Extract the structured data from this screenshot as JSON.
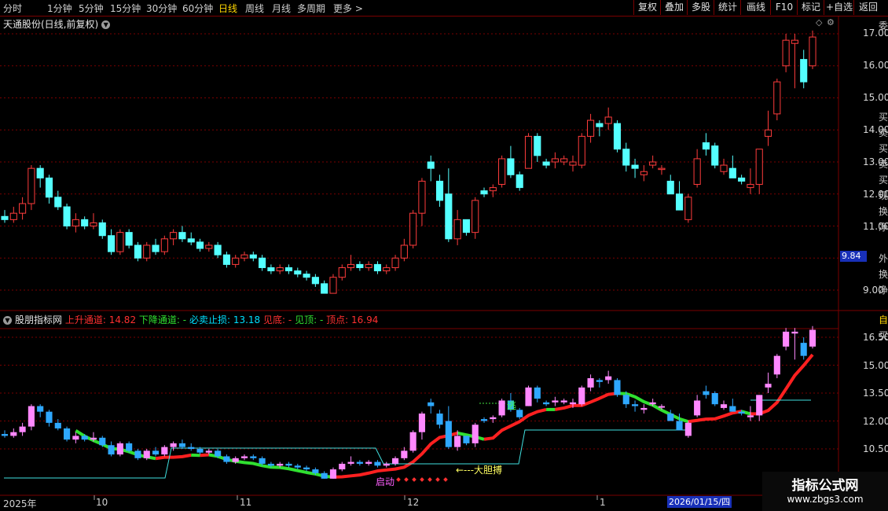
{
  "toolbar": {
    "periods": [
      "分时",
      "1分钟",
      "5分钟",
      "15分钟",
      "30分钟",
      "60分钟",
      "日线",
      "周线",
      "月线",
      "多周期",
      "更多 >"
    ],
    "active_period": "日线",
    "tools": [
      "复权",
      "叠加",
      "多股",
      "统计",
      "画线",
      "F10",
      "标记",
      "+自选",
      "返回"
    ]
  },
  "main_panel": {
    "title": "天通股份(日线,前复权)",
    "y_ticks": [
      "17.00",
      "16.00",
      "15.00",
      "14.00",
      "13.00",
      "12.00",
      "11.00",
      "9.00"
    ],
    "current_price": "9.84",
    "right_strip": [
      "委",
      "买",
      "卖",
      "买",
      "卖",
      "买",
      "现",
      "换",
      "净",
      "外",
      "换",
      "净"
    ]
  },
  "indicator_panel": {
    "name": "股朋指标网",
    "items": [
      {
        "label": "上升通道:",
        "value": "14.82",
        "color": "#ff3030"
      },
      {
        "label": "下降通道:",
        "value": "-",
        "color": "#30e030"
      },
      {
        "label": "必卖止损:",
        "value": "13.18",
        "color": "#00e0ff"
      },
      {
        "label": "见底:",
        "value": "-",
        "color": "#ff3030"
      },
      {
        "label": "见顶:",
        "value": "-",
        "color": "#30e030"
      },
      {
        "label": "顶点:",
        "value": "16.94",
        "color": "#ff3030"
      }
    ],
    "y_ticks": [
      "16.50",
      "15.00",
      "13.50",
      "12.00",
      "10.50"
    ],
    "annotations": {
      "escape": "逃",
      "bold_bet": "←---大胆搏",
      "start": "启动",
      "top_marker": "自",
      "side_marker": "买"
    }
  },
  "x_axis": {
    "labels": [
      "2025年",
      "10",
      "11",
      "12",
      "1"
    ],
    "cursor_date": "2026/01/15/四"
  },
  "watermark": {
    "title": "指标公式网",
    "url": "www.zbgs3.com"
  },
  "colors": {
    "up": "#ff3c3c",
    "down": "#54ffff",
    "ind_up": "#ff88ff",
    "ind_down": "#2ea8ff",
    "grid": "#7a0000",
    "accent": "#ffd700"
  },
  "chart_data": {
    "type": "candlestick",
    "title": "天通股份(日线,前复权)",
    "ylim": [
      8.6,
      17.4
    ],
    "ohlc": [
      [
        11.3,
        11.5,
        11.1,
        11.2
      ],
      [
        11.2,
        11.6,
        11.1,
        11.4
      ],
      [
        11.4,
        11.9,
        11.2,
        11.7
      ],
      [
        11.7,
        12.9,
        11.5,
        12.8
      ],
      [
        12.8,
        12.9,
        12.2,
        12.5
      ],
      [
        12.5,
        12.6,
        11.7,
        11.9
      ],
      [
        11.9,
        12.1,
        11.5,
        11.6
      ],
      [
        11.6,
        11.7,
        10.9,
        11.0
      ],
      [
        11.0,
        11.4,
        10.8,
        11.2
      ],
      [
        11.2,
        11.3,
        10.9,
        11.0
      ],
      [
        11.0,
        11.4,
        10.9,
        11.1
      ],
      [
        11.1,
        11.2,
        10.6,
        10.7
      ],
      [
        10.7,
        10.9,
        10.1,
        10.2
      ],
      [
        10.2,
        10.9,
        10.1,
        10.8
      ],
      [
        10.8,
        10.9,
        10.3,
        10.4
      ],
      [
        10.4,
        10.5,
        9.9,
        10.0
      ],
      [
        10.0,
        10.5,
        9.9,
        10.4
      ],
      [
        10.4,
        10.6,
        10.1,
        10.2
      ],
      [
        10.2,
        10.7,
        10.1,
        10.6
      ],
      [
        10.6,
        10.9,
        10.4,
        10.8
      ],
      [
        10.8,
        11.0,
        10.5,
        10.6
      ],
      [
        10.6,
        10.8,
        10.4,
        10.5
      ],
      [
        10.5,
        10.6,
        10.2,
        10.3
      ],
      [
        10.3,
        10.5,
        10.2,
        10.4
      ],
      [
        10.4,
        10.5,
        10.0,
        10.1
      ],
      [
        10.1,
        10.2,
        9.7,
        9.8
      ],
      [
        9.8,
        10.1,
        9.7,
        10.0
      ],
      [
        10.0,
        10.2,
        9.9,
        10.1
      ],
      [
        10.1,
        10.2,
        9.9,
        10.0
      ],
      [
        10.0,
        10.1,
        9.6,
        9.7
      ],
      [
        9.7,
        9.8,
        9.5,
        9.6
      ],
      [
        9.6,
        9.8,
        9.5,
        9.7
      ],
      [
        9.7,
        9.8,
        9.5,
        9.6
      ],
      [
        9.6,
        9.7,
        9.4,
        9.5
      ],
      [
        9.5,
        9.6,
        9.3,
        9.4
      ],
      [
        9.4,
        9.5,
        9.1,
        9.2
      ],
      [
        9.2,
        9.3,
        8.9,
        8.9
      ],
      [
        8.9,
        9.5,
        8.9,
        9.4
      ],
      [
        9.4,
        9.8,
        9.3,
        9.7
      ],
      [
        9.7,
        10.1,
        9.6,
        9.8
      ],
      [
        9.8,
        9.9,
        9.6,
        9.7
      ],
      [
        9.7,
        9.9,
        9.6,
        9.8
      ],
      [
        9.8,
        9.9,
        9.5,
        9.6
      ],
      [
        9.6,
        9.8,
        9.5,
        9.7
      ],
      [
        9.7,
        10.1,
        9.6,
        10.0
      ],
      [
        10.0,
        10.6,
        9.9,
        10.4
      ],
      [
        10.4,
        11.5,
        10.3,
        11.4
      ],
      [
        11.4,
        12.5,
        11.0,
        12.4
      ],
      [
        13.0,
        13.2,
        12.4,
        12.8
      ],
      [
        12.4,
        12.6,
        11.6,
        11.8
      ],
      [
        12.0,
        12.8,
        10.5,
        10.6
      ],
      [
        10.6,
        11.5,
        10.4,
        11.2
      ],
      [
        11.2,
        11.2,
        10.7,
        10.8
      ],
      [
        10.8,
        11.9,
        10.6,
        11.8
      ],
      [
        12.1,
        12.2,
        11.9,
        12.0
      ],
      [
        12.1,
        12.3,
        11.9,
        12.2
      ],
      [
        12.3,
        13.2,
        12.2,
        13.1
      ],
      [
        13.1,
        13.5,
        12.5,
        12.6
      ],
      [
        12.6,
        12.7,
        12.1,
        12.2
      ],
      [
        12.8,
        13.9,
        12.8,
        13.8
      ],
      [
        13.8,
        13.9,
        13.0,
        13.2
      ],
      [
        13.0,
        13.1,
        12.8,
        12.9
      ],
      [
        13.0,
        13.3,
        12.8,
        13.1
      ],
      [
        13.0,
        13.2,
        12.9,
        13.1
      ],
      [
        12.9,
        13.2,
        12.7,
        13.0
      ],
      [
        12.9,
        13.9,
        12.8,
        13.8
      ],
      [
        13.8,
        14.5,
        13.6,
        14.3
      ],
      [
        14.2,
        14.3,
        13.8,
        14.1
      ],
      [
        14.2,
        14.7,
        14.0,
        14.4
      ],
      [
        14.2,
        14.3,
        13.3,
        13.4
      ],
      [
        13.4,
        13.6,
        12.7,
        12.9
      ],
      [
        12.9,
        13.1,
        12.5,
        12.8
      ],
      [
        12.6,
        12.9,
        12.4,
        12.7
      ],
      [
        12.9,
        13.2,
        12.8,
        13.0
      ],
      [
        12.8,
        12.9,
        12.6,
        12.8
      ],
      [
        12.4,
        12.6,
        12.0,
        12.0
      ],
      [
        12.0,
        12.4,
        11.5,
        11.5
      ],
      [
        11.2,
        12.0,
        11.1,
        11.9
      ],
      [
        12.3,
        13.4,
        12.2,
        13.1
      ],
      [
        13.6,
        13.9,
        13.2,
        13.4
      ],
      [
        13.5,
        13.6,
        12.8,
        12.9
      ],
      [
        12.7,
        13.1,
        12.6,
        12.9
      ],
      [
        12.8,
        13.2,
        12.6,
        12.5
      ],
      [
        12.5,
        12.6,
        12.3,
        12.4
      ],
      [
        12.2,
        12.8,
        12.0,
        12.3
      ],
      [
        12.3,
        13.4,
        12.0,
        13.4
      ],
      [
        13.8,
        14.6,
        13.5,
        14.0
      ],
      [
        14.5,
        15.6,
        14.3,
        15.5
      ],
      [
        16.0,
        17.0,
        15.8,
        16.8
      ],
      [
        16.7,
        17.0,
        15.3,
        16.8
      ],
      [
        16.2,
        16.5,
        15.3,
        15.5
      ],
      [
        16.0,
        17.1,
        15.9,
        16.9
      ]
    ]
  }
}
